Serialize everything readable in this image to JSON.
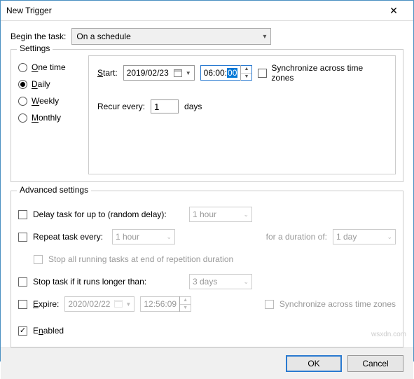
{
  "window": {
    "title": "New Trigger"
  },
  "begin": {
    "label": "Begin the task:",
    "value": "On a schedule"
  },
  "settings": {
    "legend": "Settings",
    "radios": {
      "onetime": "One time",
      "daily": "Daily",
      "weekly": "Weekly",
      "monthly": "Monthly",
      "selected": "daily"
    },
    "start_label": "Start:",
    "start_date": "2019/02/23",
    "start_time_h": "06:00:",
    "start_time_s": "00",
    "sync_label": "Synchronize across time zones",
    "recur_label": "Recur every:",
    "recur_value": "1",
    "recur_unit": "days"
  },
  "advanced": {
    "legend": "Advanced settings",
    "delay_label": "Delay task for up to (random delay):",
    "delay_value": "1 hour",
    "repeat_label": "Repeat task every:",
    "repeat_value": "1 hour",
    "duration_label": "for a duration of:",
    "duration_value": "1 day",
    "stop_repeat_label": "Stop all running tasks at end of repetition duration",
    "stop_longer_label": "Stop task if it runs longer than:",
    "stop_longer_value": "3 days",
    "expire_label": "Expire:",
    "expire_date": "2020/02/22",
    "expire_time": "12:56:09",
    "expire_sync_label": "Synchronize across time zones",
    "enabled_label": "Enabled"
  },
  "buttons": {
    "ok": "OK",
    "cancel": "Cancel"
  }
}
